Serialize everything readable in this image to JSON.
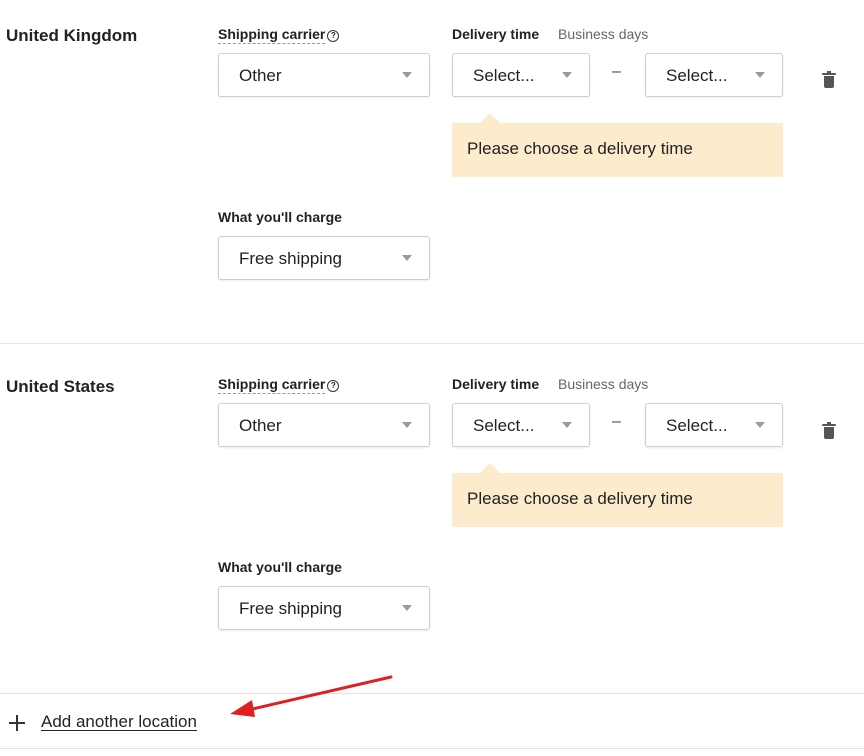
{
  "locations": [
    {
      "name": "United Kingdom",
      "carrier_label": "Shipping carrier",
      "carrier_value": "Other",
      "delivery_label": "Delivery time",
      "delivery_hint": "Business days",
      "delivery_min": "Select...",
      "delivery_max": "Select...",
      "separator": "–",
      "notice": "Please choose a delivery time",
      "charge_label": "What you'll charge",
      "charge_value": "Free shipping"
    },
    {
      "name": "United States",
      "carrier_label": "Shipping carrier",
      "carrier_value": "Other",
      "delivery_label": "Delivery time",
      "delivery_hint": "Business days",
      "delivery_min": "Select...",
      "delivery_max": "Select...",
      "separator": "–",
      "notice": "Please choose a delivery time",
      "charge_label": "What you'll charge",
      "charge_value": "Free shipping"
    }
  ],
  "add_location_label": "Add another location",
  "icons": [
    "help-circle-icon",
    "caret-down-icon",
    "trash-icon",
    "plus-icon",
    "red-arrow-annotation"
  ],
  "colors": {
    "notice_bg": "#fdebcd",
    "annotation_arrow": "#e02020",
    "text": "#222222",
    "muted": "#666666"
  }
}
